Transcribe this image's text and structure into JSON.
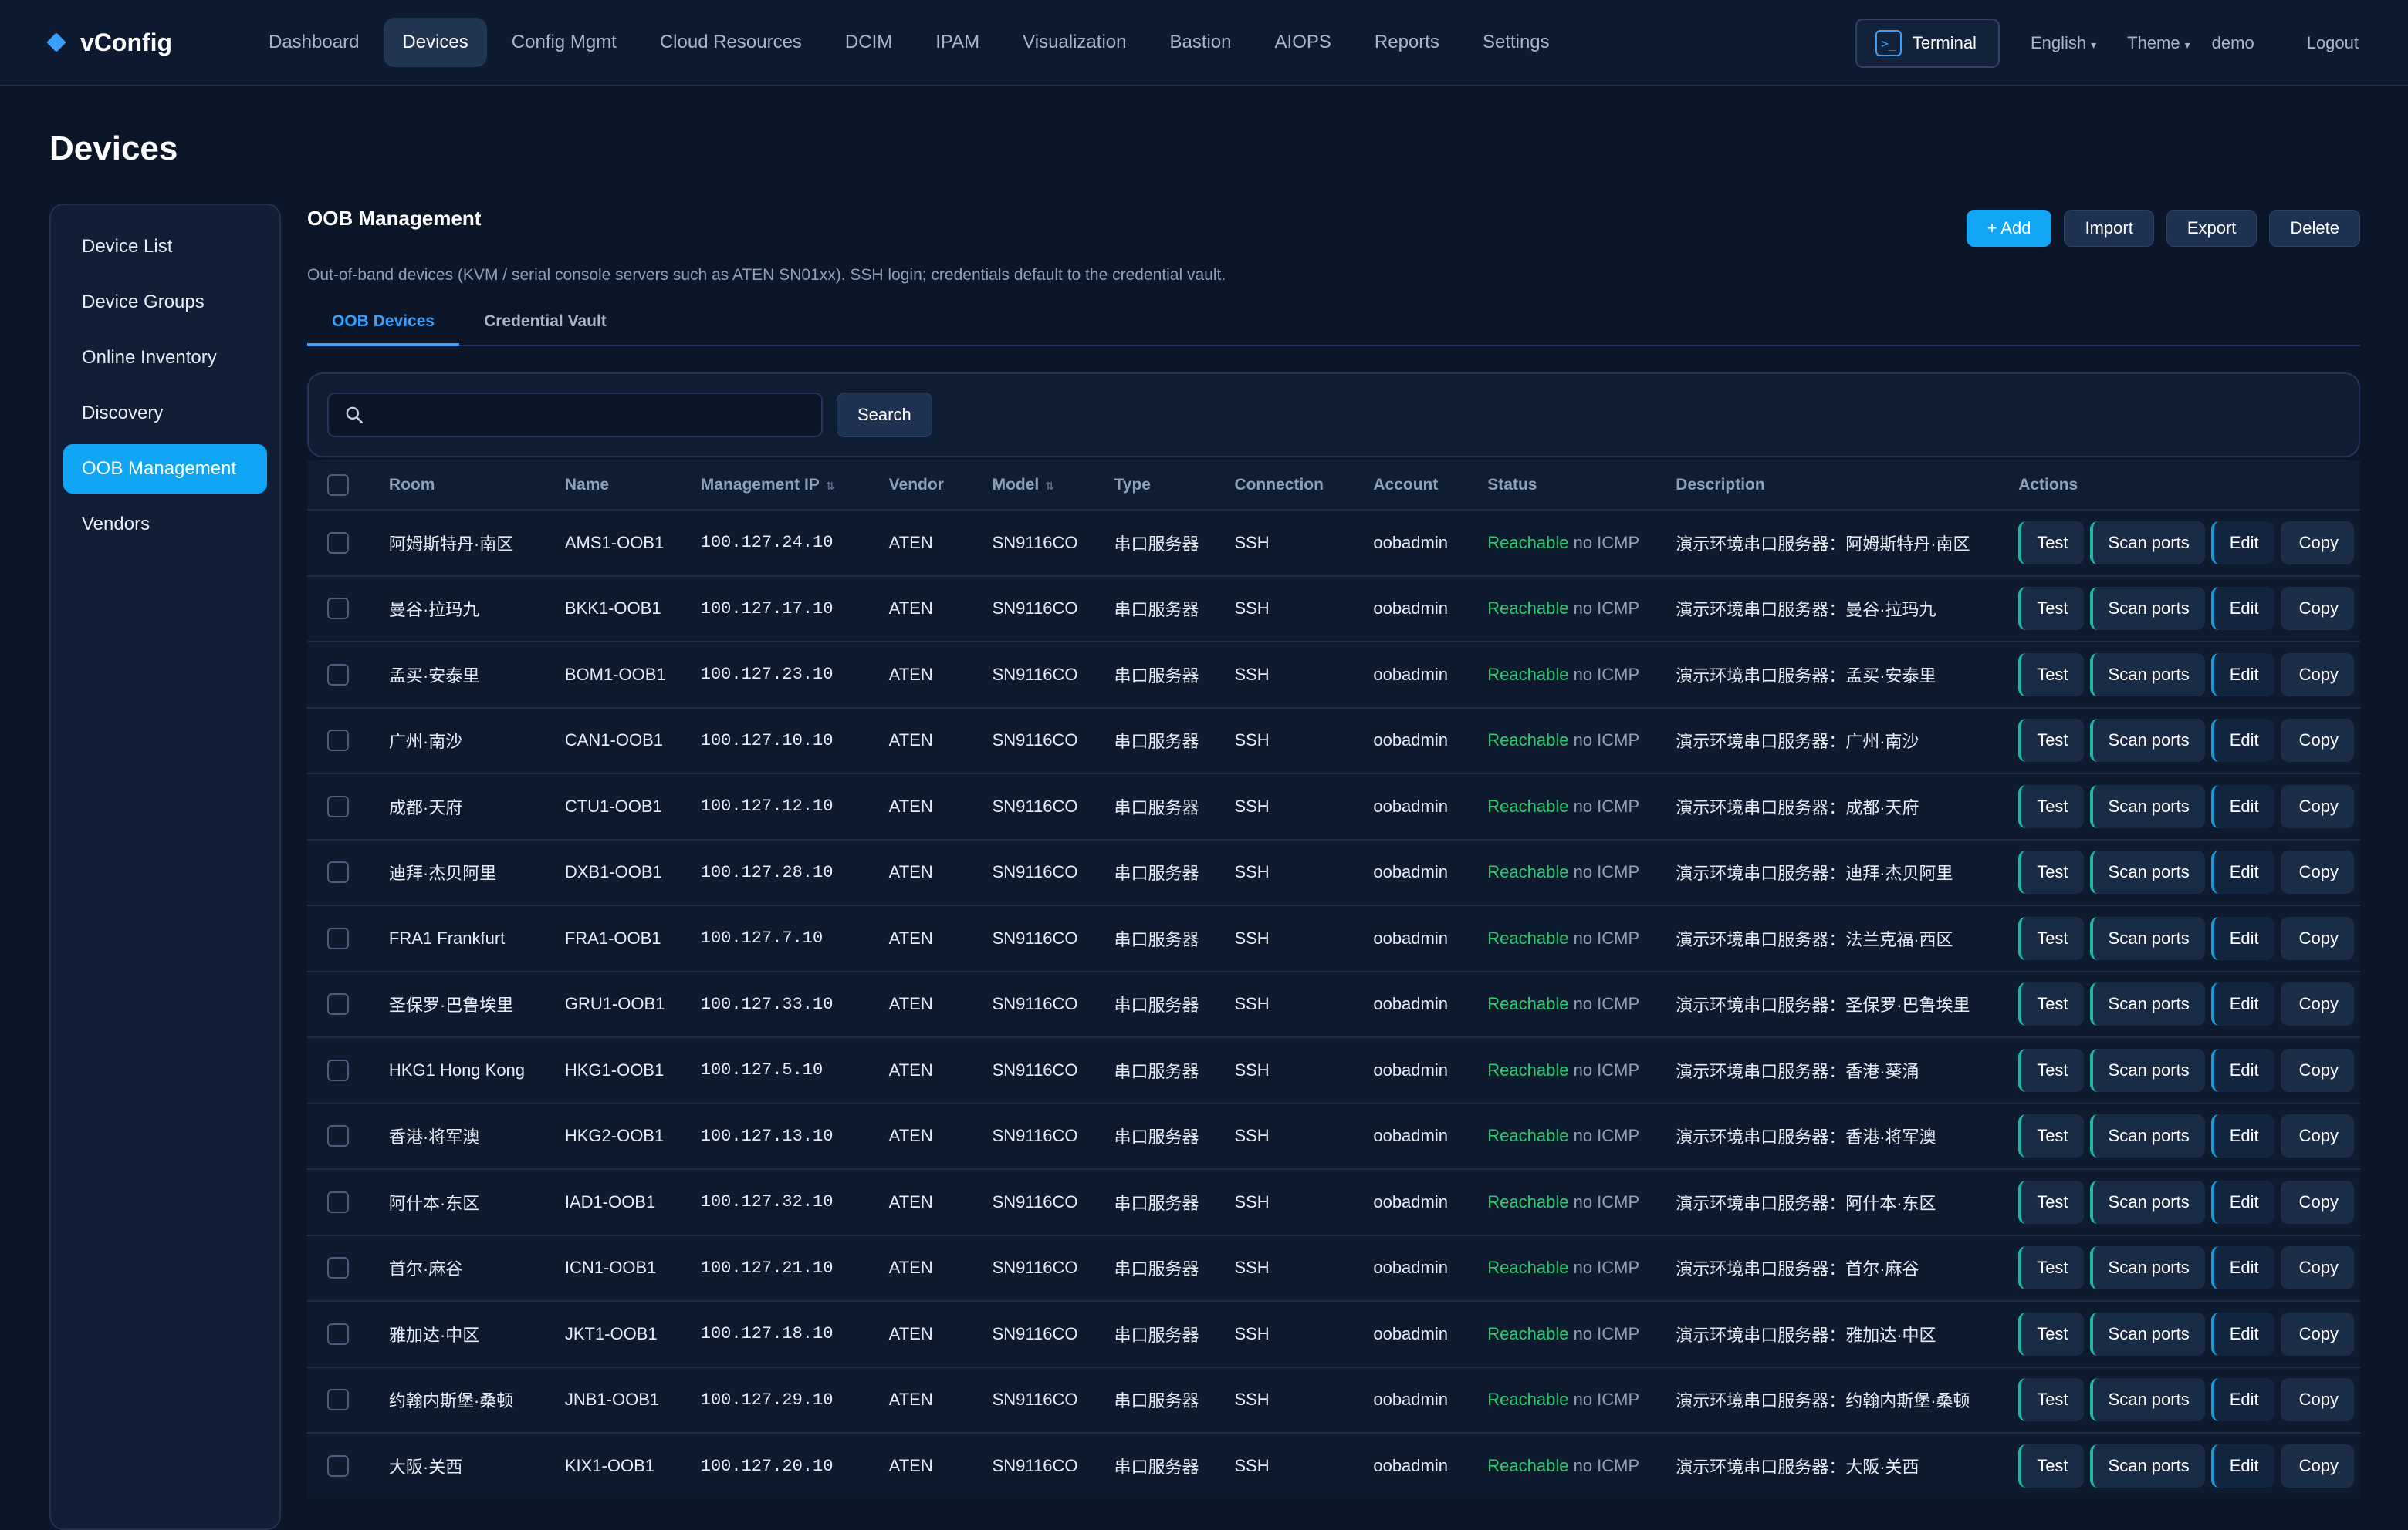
{
  "brand": {
    "name": "vConfig"
  },
  "nav": {
    "items": [
      "Dashboard",
      "Devices",
      "Config Mgmt",
      "Cloud Resources",
      "DCIM",
      "IPAM",
      "Visualization",
      "Bastion",
      "AIOPS",
      "Reports",
      "Settings"
    ],
    "active": "Devices",
    "terminal_label": "Terminal",
    "language": "English",
    "theme": "Theme",
    "user": "demo",
    "logout": "Logout"
  },
  "page": {
    "title": "Devices"
  },
  "sidebar": {
    "items": [
      "Device List",
      "Device Groups",
      "Online Inventory",
      "Discovery",
      "OOB Management",
      "Vendors"
    ],
    "active": "OOB Management"
  },
  "section": {
    "title": "OOB Management",
    "description": "Out-of-band devices (KVM / serial console servers such as ATEN SN01xx). SSH login; credentials default to the credential vault.",
    "add_label": "+ Add",
    "import_label": "Import",
    "export_label": "Export",
    "delete_label": "Delete"
  },
  "tabs": {
    "oob_devices": "OOB Devices",
    "credential_vault": "Credential Vault",
    "active": "OOB Devices"
  },
  "search": {
    "value": "",
    "button_label": "Search"
  },
  "table": {
    "columns": [
      "Room",
      "Name",
      "Management IP",
      "Vendor",
      "Model",
      "Type",
      "Connection",
      "Account",
      "Status",
      "Description",
      "Actions"
    ],
    "action_labels": {
      "test": "Test",
      "scan": "Scan ports",
      "edit": "Edit",
      "copy": "Copy"
    },
    "rows": [
      {
        "room": "阿姆斯特丹·南区",
        "name": "AMS1-OOB1",
        "ip": "100.127.24.10",
        "vendor": "ATEN",
        "model": "SN9116CO",
        "type": "串口服务器",
        "connection": "SSH",
        "account": "oobadmin",
        "status": "Reachable",
        "status_note": "no ICMP",
        "description": "演示环境串口服务器：阿姆斯特丹·南区"
      },
      {
        "room": "曼谷·拉玛九",
        "name": "BKK1-OOB1",
        "ip": "100.127.17.10",
        "vendor": "ATEN",
        "model": "SN9116CO",
        "type": "串口服务器",
        "connection": "SSH",
        "account": "oobadmin",
        "status": "Reachable",
        "status_note": "no ICMP",
        "description": "演示环境串口服务器：曼谷·拉玛九"
      },
      {
        "room": "孟买·安泰里",
        "name": "BOM1-OOB1",
        "ip": "100.127.23.10",
        "vendor": "ATEN",
        "model": "SN9116CO",
        "type": "串口服务器",
        "connection": "SSH",
        "account": "oobadmin",
        "status": "Reachable",
        "status_note": "no ICMP",
        "description": "演示环境串口服务器：孟买·安泰里"
      },
      {
        "room": "广州·南沙",
        "name": "CAN1-OOB1",
        "ip": "100.127.10.10",
        "vendor": "ATEN",
        "model": "SN9116CO",
        "type": "串口服务器",
        "connection": "SSH",
        "account": "oobadmin",
        "status": "Reachable",
        "status_note": "no ICMP",
        "description": "演示环境串口服务器：广州·南沙"
      },
      {
        "room": "成都·天府",
        "name": "CTU1-OOB1",
        "ip": "100.127.12.10",
        "vendor": "ATEN",
        "model": "SN9116CO",
        "type": "串口服务器",
        "connection": "SSH",
        "account": "oobadmin",
        "status": "Reachable",
        "status_note": "no ICMP",
        "description": "演示环境串口服务器：成都·天府"
      },
      {
        "room": "迪拜·杰贝阿里",
        "name": "DXB1-OOB1",
        "ip": "100.127.28.10",
        "vendor": "ATEN",
        "model": "SN9116CO",
        "type": "串口服务器",
        "connection": "SSH",
        "account": "oobadmin",
        "status": "Reachable",
        "status_note": "no ICMP",
        "description": "演示环境串口服务器：迪拜·杰贝阿里"
      },
      {
        "room": "FRA1 Frankfurt",
        "name": "FRA1-OOB1",
        "ip": "100.127.7.10",
        "vendor": "ATEN",
        "model": "SN9116CO",
        "type": "串口服务器",
        "connection": "SSH",
        "account": "oobadmin",
        "status": "Reachable",
        "status_note": "no ICMP",
        "description": "演示环境串口服务器：法兰克福·西区"
      },
      {
        "room": "圣保罗·巴鲁埃里",
        "name": "GRU1-OOB1",
        "ip": "100.127.33.10",
        "vendor": "ATEN",
        "model": "SN9116CO",
        "type": "串口服务器",
        "connection": "SSH",
        "account": "oobadmin",
        "status": "Reachable",
        "status_note": "no ICMP",
        "description": "演示环境串口服务器：圣保罗·巴鲁埃里"
      },
      {
        "room": "HKG1 Hong Kong",
        "name": "HKG1-OOB1",
        "ip": "100.127.5.10",
        "vendor": "ATEN",
        "model": "SN9116CO",
        "type": "串口服务器",
        "connection": "SSH",
        "account": "oobadmin",
        "status": "Reachable",
        "status_note": "no ICMP",
        "description": "演示环境串口服务器：香港·葵涌"
      },
      {
        "room": "香港·将军澳",
        "name": "HKG2-OOB1",
        "ip": "100.127.13.10",
        "vendor": "ATEN",
        "model": "SN9116CO",
        "type": "串口服务器",
        "connection": "SSH",
        "account": "oobadmin",
        "status": "Reachable",
        "status_note": "no ICMP",
        "description": "演示环境串口服务器：香港·将军澳"
      },
      {
        "room": "阿什本·东区",
        "name": "IAD1-OOB1",
        "ip": "100.127.32.10",
        "vendor": "ATEN",
        "model": "SN9116CO",
        "type": "串口服务器",
        "connection": "SSH",
        "account": "oobadmin",
        "status": "Reachable",
        "status_note": "no ICMP",
        "description": "演示环境串口服务器：阿什本·东区"
      },
      {
        "room": "首尔·麻谷",
        "name": "ICN1-OOB1",
        "ip": "100.127.21.10",
        "vendor": "ATEN",
        "model": "SN9116CO",
        "type": "串口服务器",
        "connection": "SSH",
        "account": "oobadmin",
        "status": "Reachable",
        "status_note": "no ICMP",
        "description": "演示环境串口服务器：首尔·麻谷"
      },
      {
        "room": "雅加达·中区",
        "name": "JKT1-OOB1",
        "ip": "100.127.18.10",
        "vendor": "ATEN",
        "model": "SN9116CO",
        "type": "串口服务器",
        "connection": "SSH",
        "account": "oobadmin",
        "status": "Reachable",
        "status_note": "no ICMP",
        "description": "演示环境串口服务器：雅加达·中区"
      },
      {
        "room": "约翰内斯堡·桑顿",
        "name": "JNB1-OOB1",
        "ip": "100.127.29.10",
        "vendor": "ATEN",
        "model": "SN9116CO",
        "type": "串口服务器",
        "connection": "SSH",
        "account": "oobadmin",
        "status": "Reachable",
        "status_note": "no ICMP",
        "description": "演示环境串口服务器：约翰内斯堡·桑顿"
      },
      {
        "room": "大阪·关西",
        "name": "KIX1-OOB1",
        "ip": "100.127.20.10",
        "vendor": "ATEN",
        "model": "SN9116CO",
        "type": "串口服务器",
        "connection": "SSH",
        "account": "oobadmin",
        "status": "Reachable",
        "status_note": "no ICMP",
        "description": "演示环境串口服务器：大阪·关西"
      }
    ]
  }
}
